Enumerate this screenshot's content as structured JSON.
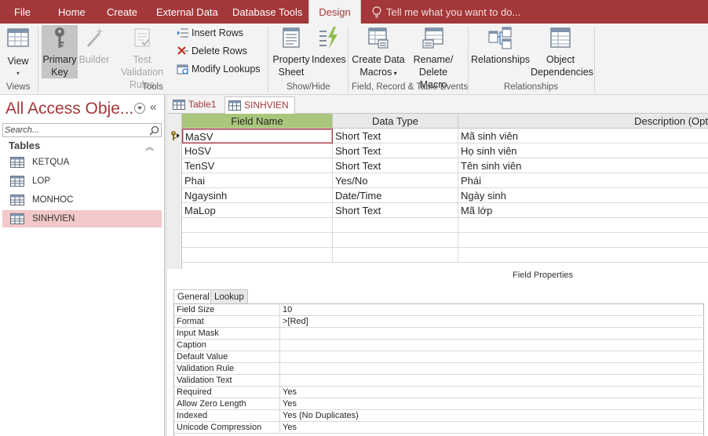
{
  "menu": {
    "items": [
      "File",
      "Home",
      "Create",
      "External Data",
      "Database Tools",
      "Design"
    ],
    "active": "Design",
    "tell_me": "Tell me what you want to do..."
  },
  "ribbon": {
    "view": "View",
    "primary_key_1": "Primary",
    "primary_key_2": "Key",
    "builder": "Builder",
    "test_validation_1": "Test Validation",
    "test_validation_2": "Rules",
    "insert_rows": "Insert Rows",
    "delete_rows": "Delete Rows",
    "modify_lookups": "Modify Lookups",
    "property_sheet_1": "Property",
    "property_sheet_2": "Sheet",
    "indexes": "Indexes",
    "create_data_macros_1": "Create Data",
    "create_data_macros_2": "Macros",
    "rename_delete_macro_1": "Rename/",
    "rename_delete_macro_2": "Delete Macro",
    "relationships": "Relationships",
    "object_dependencies_1": "Object",
    "object_dependencies_2": "Dependencies",
    "groups": {
      "views": "Views",
      "tools": "Tools",
      "show_hide": "Show/Hide",
      "field_record_table_events": "Field, Record & Table Events",
      "relationships": "Relationships"
    }
  },
  "nav": {
    "title": "All Access Obje...",
    "search_placeholder": "Search...",
    "section": "Tables",
    "items": [
      "KETQUA",
      "LOP",
      "MONHOC",
      "SINHVIEN"
    ],
    "selected": "SINHVIEN"
  },
  "doc_tabs": [
    "Table1",
    "SINHVIEN"
  ],
  "active_tab": "SINHVIEN",
  "grid": {
    "headers": [
      "Field Name",
      "Data Type",
      "Description (Opt"
    ],
    "rows": [
      {
        "field": "MaSV",
        "type": "Short Text",
        "desc": "Mã sinh viên",
        "key": true
      },
      {
        "field": "HoSV",
        "type": "Short Text",
        "desc": "Họ sinh viên"
      },
      {
        "field": "TenSV",
        "type": "Short Text",
        "desc": "Tên sinh viên"
      },
      {
        "field": "Phai",
        "type": "Yes/No",
        "desc": "Phái"
      },
      {
        "field": "Ngaysinh",
        "type": "Date/Time",
        "desc": "Ngày sinh"
      },
      {
        "field": "MaLop",
        "type": "Short Text",
        "desc": "Mã lớp"
      }
    ]
  },
  "field_properties": {
    "title": "Field Properties",
    "tabs": [
      "General",
      "Lookup"
    ],
    "active_tab": "General",
    "rows": [
      {
        "name": "Field Size",
        "value": "10"
      },
      {
        "name": "Format",
        "value": ">[Red]"
      },
      {
        "name": "Input Mask",
        "value": ""
      },
      {
        "name": "Caption",
        "value": ""
      },
      {
        "name": "Default Value",
        "value": ""
      },
      {
        "name": "Validation Rule",
        "value": ""
      },
      {
        "name": "Validation Text",
        "value": ""
      },
      {
        "name": "Required",
        "value": "Yes"
      },
      {
        "name": "Allow Zero Length",
        "value": "Yes"
      },
      {
        "name": "Indexed",
        "value": "Yes (No Duplicates)"
      },
      {
        "name": "Unicode Compression",
        "value": "Yes"
      }
    ]
  },
  "colors": {
    "accent": "#a4373a",
    "field_name_header": "#a9c77b",
    "nav_selected": "#f2c8c8"
  }
}
